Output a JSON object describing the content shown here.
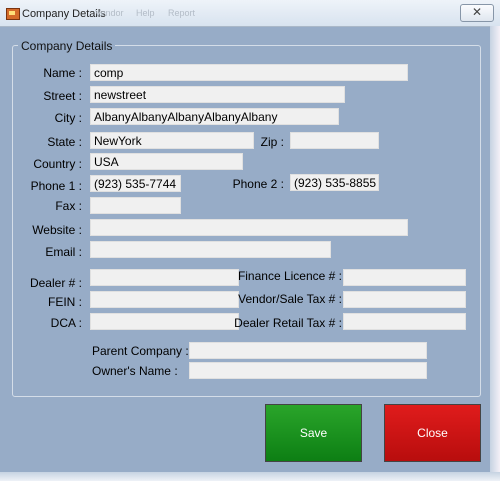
{
  "window": {
    "title": "Company Details",
    "close_glyph": "✕",
    "ghost_menu": [
      "Vendor",
      "Help",
      "Report"
    ]
  },
  "group": {
    "title": "Company Details"
  },
  "fields": {
    "name": {
      "label": "Name :",
      "value": "comp"
    },
    "street": {
      "label": "Street :",
      "value": "newstreet"
    },
    "city": {
      "label": "City :",
      "value": "AlbanyAlbanyAlbanyAlbanyAlbany"
    },
    "state": {
      "label": "State :",
      "value": "NewYork"
    },
    "zip": {
      "label": "Zip :",
      "value": ""
    },
    "country": {
      "label": "Country :",
      "value": "USA"
    },
    "phone1": {
      "label": "Phone 1 :",
      "value": "(923) 535-7744"
    },
    "phone2": {
      "label": "Phone 2 :",
      "value": "(923) 535-8855"
    },
    "fax": {
      "label": "Fax :",
      "value": ""
    },
    "website": {
      "label": "Website :",
      "value": ""
    },
    "email": {
      "label": "Email :",
      "value": ""
    },
    "dealer": {
      "label": "Dealer # :",
      "value": ""
    },
    "fein": {
      "label": "FEIN :",
      "value": ""
    },
    "dca": {
      "label": "DCA :",
      "value": ""
    },
    "finance_licence": {
      "label": "Finance Licence # :",
      "value": ""
    },
    "vendor_sale_tax": {
      "label": "Vendor/Sale Tax # :",
      "value": ""
    },
    "dealer_retail_tax": {
      "label": "Dealer Retail Tax # :",
      "value": ""
    },
    "parent_company": {
      "label": "Parent Company :",
      "value": ""
    },
    "owners_name": {
      "label": "Owner's Name :",
      "value": ""
    }
  },
  "buttons": {
    "save": "Save",
    "close": "Close"
  },
  "colors": {
    "save": "#16901c",
    "close": "#c81414",
    "background": "#97acc7"
  }
}
